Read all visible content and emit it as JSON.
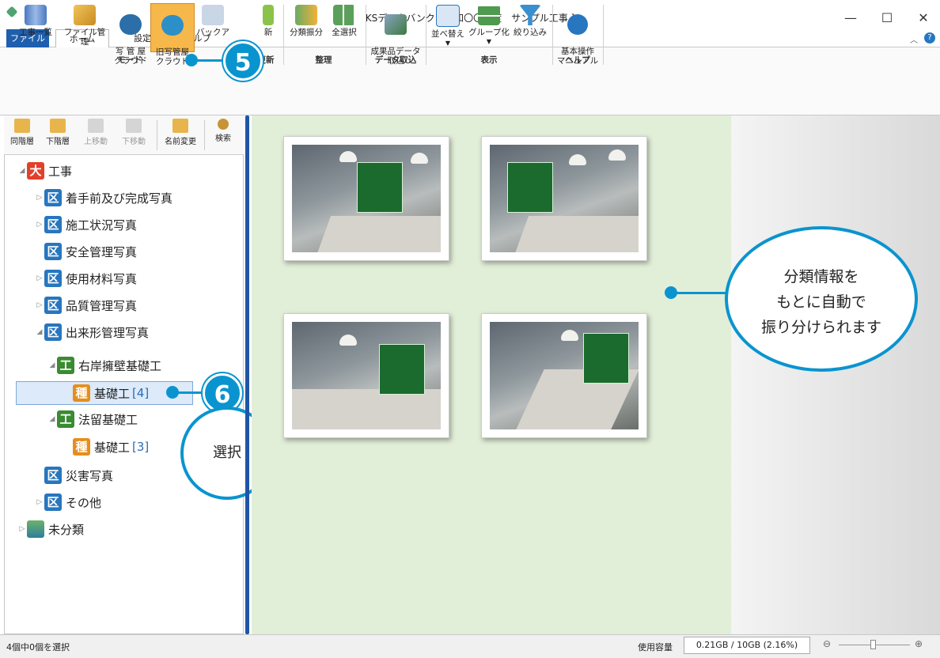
{
  "window": {
    "title": "KSデータバンク [ 令和〇〇年度　サンプル工事 ]",
    "minimize": "—",
    "maximize": "☐",
    "close": "✕"
  },
  "menu": {
    "tabs": [
      "ファイル",
      "ホーム",
      "設定",
      "ヘルプ"
    ],
    "active_tab": "ホーム"
  },
  "ribbon": {
    "buttons": {
      "project_list": "工事一覧",
      "file_manage": "ファイル管理",
      "photo_cloud": "写 管 屋\nクラウド",
      "old_photo_cloud": "旧写管屋\nクラウド",
      "backup": "バックア",
      "update": "新",
      "classify": "分類振分",
      "select_all": "全選択",
      "deliverable_import": "成果品データ\n取込",
      "sort": "並べ替え",
      "group": "グループ化",
      "filter": "絞り込み",
      "manual": "基本操作\nマニュアル"
    },
    "groups": {
      "mode": "モード",
      "update": "更新",
      "organize": "整理",
      "data_import": "データ取込",
      "display": "表示",
      "help": "ヘルプ"
    }
  },
  "left_toolbar": {
    "same_level": "同階層",
    "lower_level": "下階層",
    "move_up": "上移動",
    "move_down": "下移動",
    "rename": "名前変更",
    "search": "検索"
  },
  "tree": {
    "root": {
      "badge": "大",
      "label": "工事"
    },
    "items": [
      {
        "badge": "区",
        "label": "着手前及び完成写真"
      },
      {
        "badge": "区",
        "label": "施工状況写真"
      },
      {
        "badge": "区",
        "label": "安全管理写真"
      },
      {
        "badge": "区",
        "label": "使用材料写真"
      },
      {
        "badge": "区",
        "label": "品質管理写真"
      },
      {
        "badge": "区",
        "label": "出来形管理写真"
      },
      {
        "badge": "工",
        "label": "右岸擁壁基礎工"
      },
      {
        "badge": "種",
        "label": "基礎工",
        "count": "[4]"
      },
      {
        "badge": "工",
        "label": "法留基礎工"
      },
      {
        "badge": "種",
        "label": "基礎工",
        "count": "[3]"
      },
      {
        "badge": "区",
        "label": "災害写真"
      },
      {
        "badge": "区",
        "label": "その他"
      }
    ],
    "unclassified": "未分類"
  },
  "callouts": {
    "step5": "5",
    "step6": "6",
    "select_text": "選択",
    "auto_sort_text": "分類情報を\nもとに自動で\n振り分けられます"
  },
  "status": {
    "selection": "4個中0個を選択",
    "usage_label": "使用容量",
    "usage_value": "0.21GB / 10GB (2.16%)"
  },
  "colors": {
    "accent": "#0a94cf",
    "main_bg": "#e2efd8",
    "splitter": "#1e55a6"
  }
}
